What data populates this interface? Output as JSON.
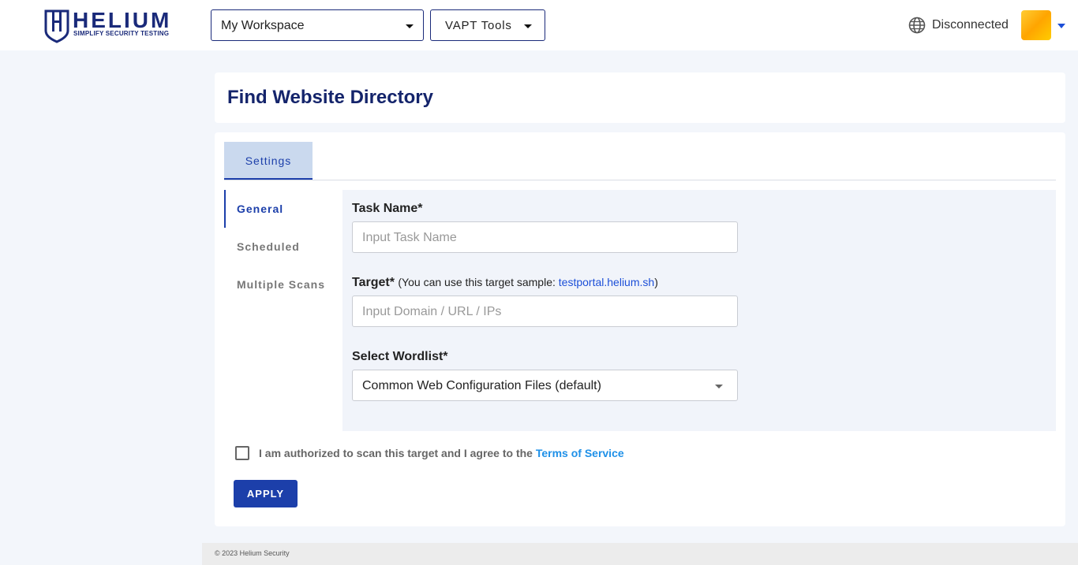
{
  "header": {
    "brand": "HELIUM",
    "tagline": "SIMPLIFY SECURITY TESTING",
    "workspace_select": "My Workspace",
    "tools_button": "VAPT Tools",
    "connection_status": "Disconnected"
  },
  "page": {
    "title": "Find Website Directory"
  },
  "tabs": [
    {
      "label": "Settings",
      "active": true
    }
  ],
  "side_nav": [
    {
      "label": "General",
      "active": true
    },
    {
      "label": "Scheduled",
      "active": false
    },
    {
      "label": "Multiple Scans",
      "active": false
    }
  ],
  "form": {
    "task_name_label": "Task Name*",
    "task_name_placeholder": "Input Task Name",
    "target_label": "Target*",
    "target_hint_prefix": "(You can use this target sample: ",
    "target_hint_link": "testportal.helium.sh",
    "target_hint_suffix": ")",
    "target_placeholder": "Input Domain / URL / IPs",
    "wordlist_label": "Select Wordlist*",
    "wordlist_value": "Common Web Configuration Files (default)"
  },
  "consent": {
    "text": "I am authorized to scan this target and I agree to the ",
    "link": "Terms of Service",
    "checked": false
  },
  "apply_button": "APPLY",
  "footer": "© 2023 Helium Security",
  "colors": {
    "brand_navy": "#14246b",
    "primary": "#1c3faa",
    "link": "#1e90e8",
    "background": "#f3f6fb"
  },
  "icons": [
    "shield-logo-icon",
    "caret-down-icon",
    "globe-icon"
  ]
}
